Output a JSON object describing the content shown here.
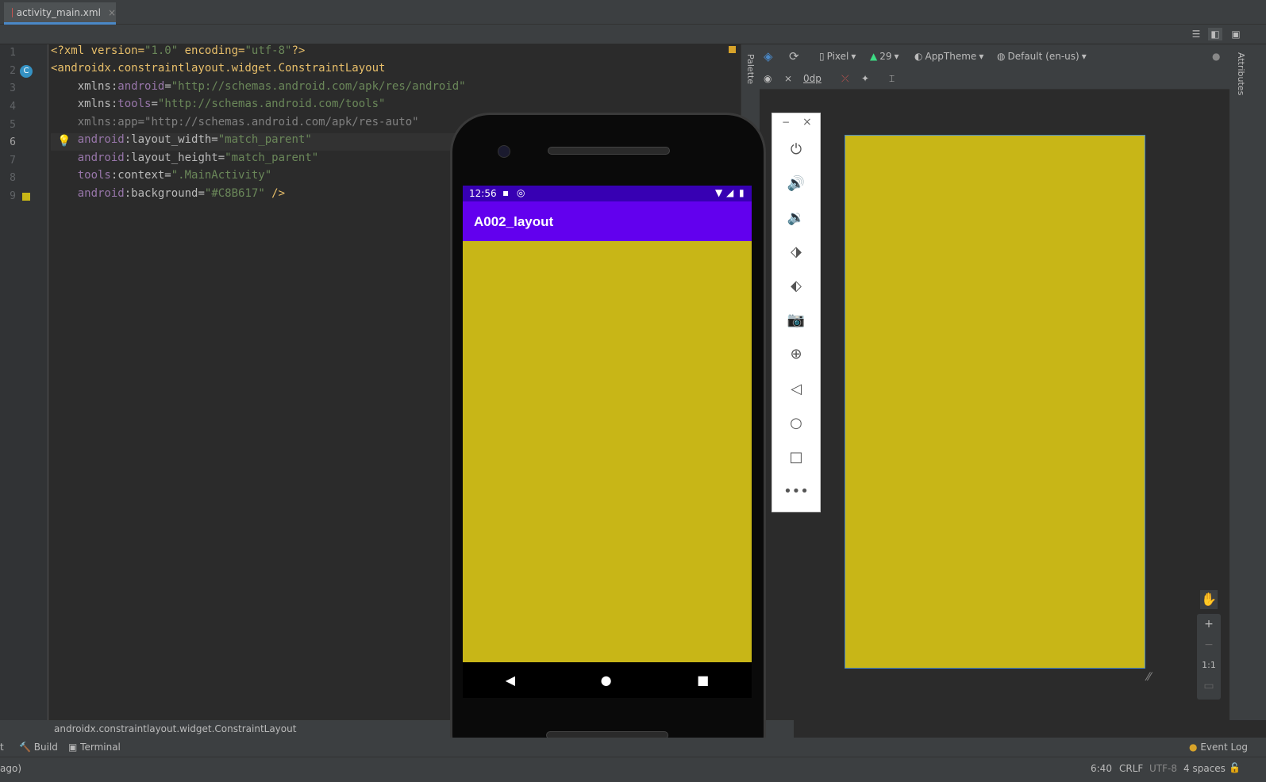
{
  "tab": {
    "filename": "activity_main.xml",
    "close": "×"
  },
  "editor": {
    "line_numbers": [
      "1",
      "2",
      "3",
      "4",
      "5",
      "6",
      "7",
      "8",
      "9"
    ],
    "lines": [
      [
        "<?xml version=",
        "\"1.0\"",
        " encoding=",
        "\"utf-8\"",
        "?>"
      ],
      [
        "<androidx.constraintlayout.widget.ConstraintLayout"
      ],
      [
        "    xmlns:",
        "android",
        "=",
        "\"http://schemas.android.com/apk/res/android\""
      ],
      [
        "    xmlns:",
        "tools",
        "=",
        "\"http://schemas.android.com/tools\""
      ],
      [
        "    xmlns:app=",
        "\"http://schemas.android.com/apk/res-auto\""
      ],
      [
        "    ",
        "android",
        ":layout_width=",
        "\"match_parent\""
      ],
      [
        "    ",
        "android",
        ":layout_height=",
        "\"match_parent\""
      ],
      [
        "    ",
        "tools",
        ":context=",
        "\".MainActivity\""
      ],
      [
        "    ",
        "android",
        ":background=",
        "\"#C8B617\"",
        " />"
      ]
    ],
    "breadcrumb": "androidx.constraintlayout.widget.ConstraintLayout"
  },
  "design_toolbar": {
    "device": "Pixel",
    "api": "29",
    "theme": "AppTheme",
    "locale": "Default (en-us)",
    "margin": "0dp"
  },
  "side_tabs": {
    "palette": "Palette",
    "attributes": "Attributes"
  },
  "zoom": {
    "plus": "+",
    "minus": "−",
    "reset": "1:1"
  },
  "phone": {
    "time": "12:56",
    "app_title": "A002_layout",
    "background": "#C8B617",
    "appbar_color": "#6200ee",
    "statusbar_color": "#3700b3"
  },
  "emulator_panel": {
    "buttons": [
      "power-icon",
      "volume-up-icon",
      "volume-down-icon",
      "rotate-left-icon",
      "rotate-right-icon",
      "camera-icon",
      "zoom-icon",
      "back-icon",
      "home-icon",
      "overview-icon",
      "more-icon"
    ],
    "minimize": "−",
    "close": "×"
  },
  "bottom_tools": {
    "build": "Build",
    "terminal": "Terminal",
    "event_log": "Event Log",
    "left_fragment": "t",
    "left_status": "ago)"
  },
  "status": {
    "position": "6:40",
    "line_sep": "CRLF",
    "encoding": "UTF-8",
    "indent": "4 spaces"
  }
}
